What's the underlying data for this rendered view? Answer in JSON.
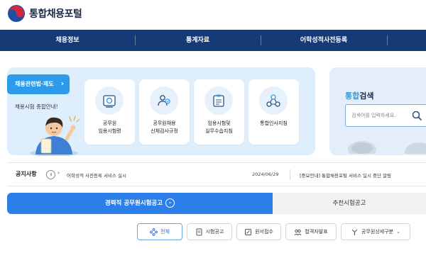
{
  "header": {
    "logo_text": "통합채용포털"
  },
  "nav": {
    "items": [
      "채용정보",
      "통계자료",
      "어학성적사전등록"
    ]
  },
  "hero": {
    "pill_label": "채용관련법·제도",
    "subtitle": "채용시험 종합안내!",
    "cards": [
      {
        "label": "공무원\n임용시험령",
        "icon": "book-icon"
      },
      {
        "label": "공무원채용\n신체검사규정",
        "icon": "person-check-icon"
      },
      {
        "label": "임용시험및\n실무수습지침",
        "icon": "clipboard-icon"
      },
      {
        "label": "통합인사지침",
        "icon": "network-icon"
      }
    ]
  },
  "search": {
    "title_highlight": "통합",
    "title_rest": "검색",
    "placeholder": "검색어를 입력하세요."
  },
  "notices": {
    "title": "공지사항",
    "item1_text": "어학성적 사전등록 서비스 실시",
    "item1_date": "2024/06/29",
    "item2_text": "[중요안내] 통합채용포털 서비스 일시 중단 알림"
  },
  "tabs": {
    "active": "경력직 공무원시험공고",
    "inactive": "추천시험공고"
  },
  "filters": [
    "전체",
    "시험공고",
    "원서접수",
    "합격자발표",
    "공무원상세구분"
  ],
  "colors": {
    "nav": "#163a75",
    "accent": "#2c9bea",
    "tab_active": "#2c7fe8"
  }
}
